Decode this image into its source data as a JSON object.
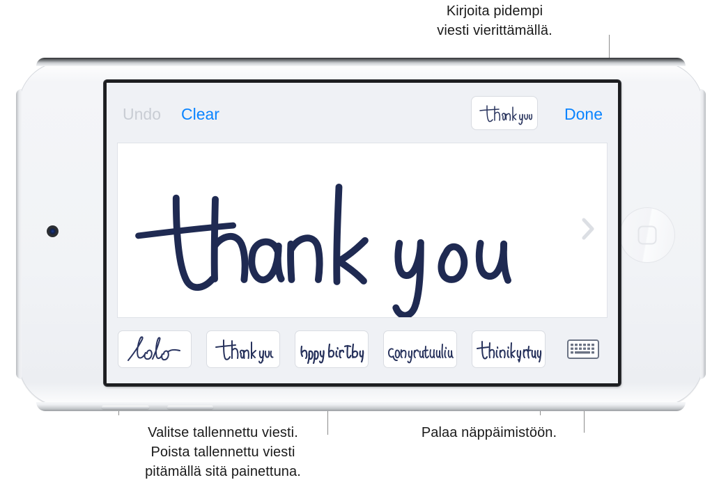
{
  "callouts": {
    "top_right": "Kirjoita pidempi\nviesti vierittämällä.",
    "bottom_left": "Valitse tallennettu viesti.\nPoista tallennettu viesti\npitämällä sitä painettuna.",
    "bottom_right": "Palaa näppäimistöön."
  },
  "device": {
    "name": "ipod-touch",
    "front_camera": "front-camera",
    "home_button": "home-button",
    "volume_up": "volume-up-button",
    "volume_down": "volume-down-button"
  },
  "screen": {
    "toolbar": {
      "undo_label": "Undo",
      "undo_enabled": "false",
      "clear_label": "Clear",
      "done_label": "Done",
      "preview_text": "thank you"
    },
    "canvas": {
      "handwriting_text": "thank you",
      "scroll_hint_icon": "chevron-right-icon",
      "ink_color": "#1f2a52",
      "background": "#ffffff"
    },
    "saved_messages": [
      {
        "text": "hello"
      },
      {
        "text": "thank you"
      },
      {
        "text": "happy birthday"
      },
      {
        "text": "congratulations"
      },
      {
        "text": "thinking of you"
      }
    ],
    "keyboard_button": {
      "icon": "keyboard-icon",
      "label": "Palaa näppäimistöön"
    }
  },
  "colors": {
    "accent_blue": "#0a84ff",
    "disabled_gray": "#c9cdd4",
    "toolbar_bg": "#eff1f5",
    "ink": "#1f2a52",
    "keyboard_icon": "#6b7384"
  }
}
